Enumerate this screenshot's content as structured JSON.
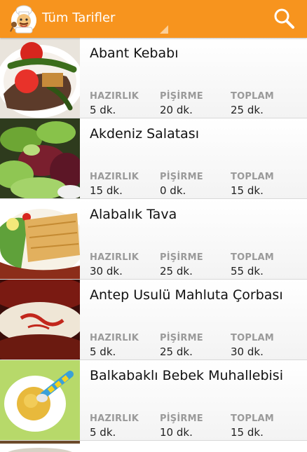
{
  "action_bar": {
    "title": "Tüm Tarifler",
    "icon": "chef-icon",
    "search_icon": "search-icon",
    "color": "#f7941e"
  },
  "recipes": [
    {
      "name": "Abant Kebabı",
      "prep_label": "HAZIRLIK",
      "prep": "5 dk.",
      "cook_label": "PİŞİRME",
      "cook": "20 dk.",
      "total_label": "TOPLAM",
      "total": "25 dk."
    },
    {
      "name": "Akdeniz Salatası",
      "prep_label": "HAZIRLIK",
      "prep": "15 dk.",
      "cook_label": "PİŞİRME",
      "cook": "0 dk.",
      "total_label": "TOPLAM",
      "total": "15 dk."
    },
    {
      "name": "Alabalık Tava",
      "prep_label": "HAZIRLIK",
      "prep": "30 dk.",
      "cook_label": "PİŞİRME",
      "cook": "25 dk.",
      "total_label": "TOPLAM",
      "total": "55 dk."
    },
    {
      "name": "Antep Usulü Mahluta Çorbası",
      "prep_label": "HAZIRLIK",
      "prep": "5 dk.",
      "cook_label": "PİŞİRME",
      "cook": "25 dk.",
      "total_label": "TOPLAM",
      "total": "30 dk."
    },
    {
      "name": "Balkabaklı Bebek Muhallebisi",
      "prep_label": "HAZIRLIK",
      "prep": "5 dk.",
      "cook_label": "PİŞİRME",
      "cook": "10 dk.",
      "total_label": "TOPLAM",
      "total": "15 dk."
    }
  ]
}
